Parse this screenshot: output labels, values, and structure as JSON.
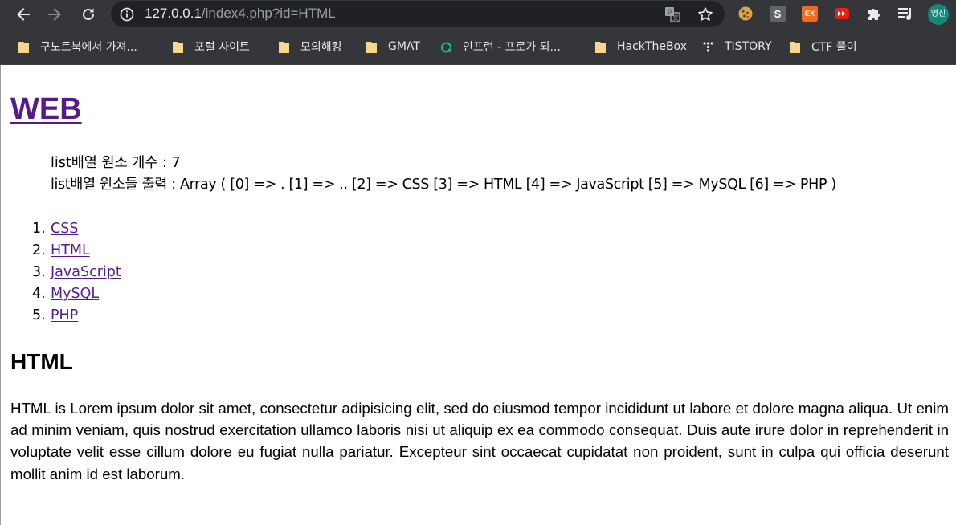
{
  "browser": {
    "url_host": "127.0.0.1",
    "url_path": "/index4.php?id=HTML",
    "extensions": [
      "cookie-icon",
      "s-extension-icon",
      "ex-extension-icon",
      "video-extension-icon",
      "puzzle-extensions-icon",
      "reading-list-icon"
    ],
    "ext_s_label": "S",
    "ext_ex_label": "EX",
    "profile_label": "영진",
    "bookmarks": [
      {
        "label": "구노트북에서 가져...",
        "icon": "folder-icon"
      },
      {
        "label": "포털 사이트",
        "icon": "folder-icon"
      },
      {
        "label": "모의해킹",
        "icon": "folder-icon"
      },
      {
        "label": "GMAT",
        "icon": "folder-icon"
      },
      {
        "label": "인프런 - 프로가 되...",
        "icon": "inflearn-icon"
      },
      {
        "label": "HackTheBox",
        "icon": "folder-icon"
      },
      {
        "label": "TISTORY",
        "icon": "tistory-icon"
      },
      {
        "label": "CTF 풀이",
        "icon": "folder-icon"
      }
    ],
    "colors": {
      "chrome_bg": "#35363a",
      "omnibox_bg": "#202124",
      "folder": "#f6d78b",
      "link_visited": "#551a8b",
      "profile": "#128a7a"
    }
  },
  "page": {
    "title": "WEB",
    "list_count": "list배열 원소 개수 : 7",
    "list_dump": "list배열 원소들 출력 : Array ( [0] => . [1] => .. [2] => CSS [3] => HTML [4] => JavaScript [5] => MySQL [6] => PHP )",
    "topics": [
      {
        "num": "1.",
        "label": "CSS"
      },
      {
        "num": "2.",
        "label": "HTML"
      },
      {
        "num": "3.",
        "label": "JavaScript"
      },
      {
        "num": "4.",
        "label": "MySQL"
      },
      {
        "num": "5.",
        "label": "PHP"
      }
    ],
    "topic_title": "HTML",
    "description": "HTML is Lorem ipsum dolor sit amet, consectetur adipisicing elit, sed do eiusmod tempor incididunt ut labore et dolore magna aliqua. Ut enim ad minim veniam, quis nostrud exercitation ullamco laboris nisi ut aliquip ex ea commodo consequat. Duis aute irure dolor in reprehenderit in voluptate velit esse cillum dolore eu fugiat nulla pariatur. Excepteur sint occaecat cupidatat non proident, sunt in culpa qui officia deserunt mollit anim id est laborum."
  }
}
